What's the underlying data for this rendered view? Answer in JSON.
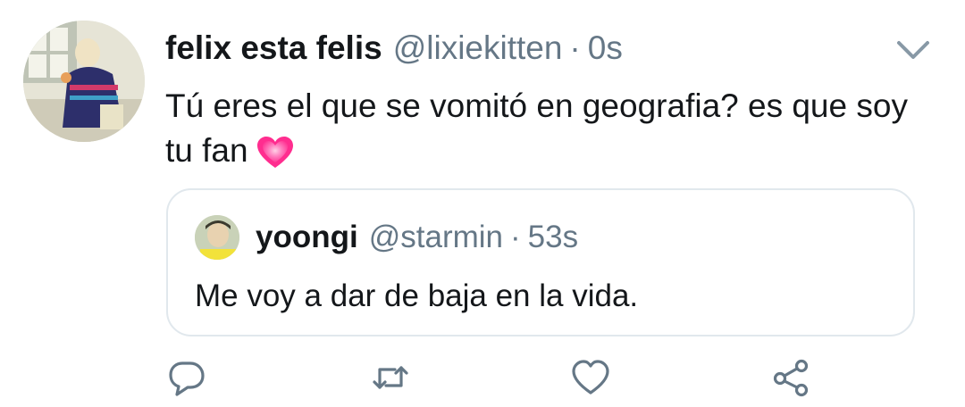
{
  "tweet": {
    "display_name": "felix esta felis",
    "handle": "@lixiekitten",
    "separator": "·",
    "time": "0s",
    "text": "Tú eres el que se vomitó en geografia? es que soy tu fan",
    "emoji": "growing-heart-emoji",
    "avatar": "profile-photo"
  },
  "quoted_tweet": {
    "display_name": "yoongi",
    "handle": "@starmin",
    "separator": "·",
    "time": "53s",
    "text": "Me voy a dar de baja en la vida.",
    "avatar": "profile-photo"
  },
  "actions": [
    {
      "icon": "reply-icon"
    },
    {
      "icon": "retweet-icon"
    },
    {
      "icon": "like-icon"
    },
    {
      "icon": "share-icon"
    }
  ],
  "menu": {
    "icon": "chevron-down-icon"
  },
  "colors": {
    "text_primary": "#14171a",
    "text_secondary": "#657786",
    "border": "#e1e8ed",
    "action_icon": "#657786",
    "heart_emoji": "#ff4fa0"
  }
}
